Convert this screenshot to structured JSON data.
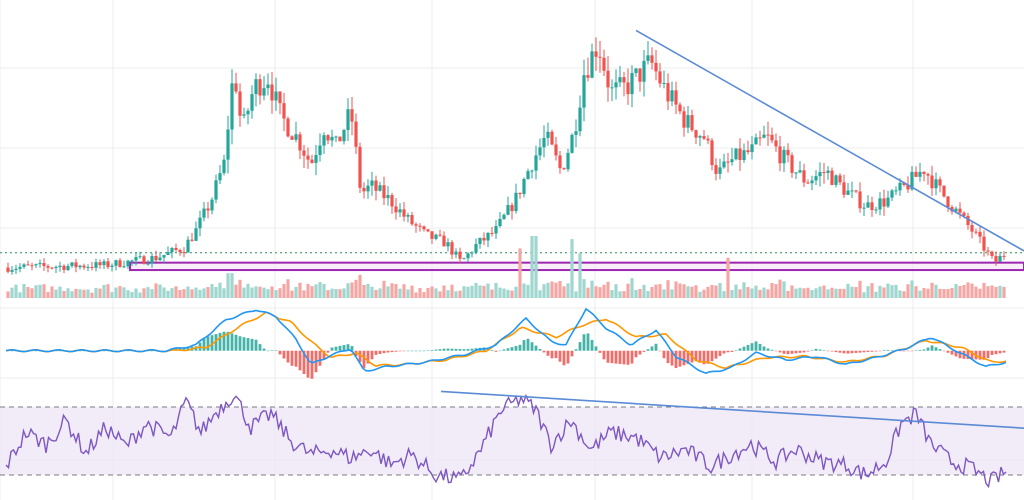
{
  "colors": {
    "up": "#26a69a",
    "down": "#ef5350",
    "volume_up": "#9fd6cf",
    "volume_down": "#f3a6a3",
    "grid": "#ececec",
    "trendline": "#5b8bd6",
    "support_zone_stroke": "#9c27b0",
    "support_zone_fill": "#f3e5f5",
    "dotted_level": "#2e8b57",
    "macd_line": "#2196f3",
    "signal_line": "#ff9800",
    "rsi_line": "#7e57c2",
    "rsi_band_fill": "#ede7f6",
    "rsi_band_stroke": "#787b86"
  },
  "chart_data": [
    {
      "type": "candlestick",
      "panel": "price",
      "title": "",
      "xlabel": "",
      "ylabel": "",
      "grid": true,
      "ylim": [
        0,
        100
      ],
      "x_range": [
        0,
        1
      ],
      "price_path": [
        [
          0.0,
          3
        ],
        [
          0.1,
          4
        ],
        [
          0.15,
          7
        ],
        [
          0.178,
          11
        ],
        [
          0.19,
          18
        ],
        [
          0.205,
          30
        ],
        [
          0.218,
          45
        ],
        [
          0.228,
          84
        ],
        [
          0.236,
          58
        ],
        [
          0.248,
          76
        ],
        [
          0.262,
          80
        ],
        [
          0.275,
          64
        ],
        [
          0.292,
          55
        ],
        [
          0.305,
          45
        ],
        [
          0.318,
          60
        ],
        [
          0.33,
          52
        ],
        [
          0.345,
          66
        ],
        [
          0.355,
          33
        ],
        [
          0.365,
          36
        ],
        [
          0.385,
          30
        ],
        [
          0.4,
          23
        ],
        [
          0.42,
          16
        ],
        [
          0.44,
          13
        ],
        [
          0.455,
          5
        ],
        [
          0.47,
          12
        ],
        [
          0.49,
          18
        ],
        [
          0.51,
          31
        ],
        [
          0.525,
          45
        ],
        [
          0.54,
          56
        ],
        [
          0.555,
          42
        ],
        [
          0.568,
          58
        ],
        [
          0.578,
          82
        ],
        [
          0.592,
          94
        ],
        [
          0.605,
          74
        ],
        [
          0.62,
          76
        ],
        [
          0.635,
          82
        ],
        [
          0.645,
          86
        ],
        [
          0.66,
          74
        ],
        [
          0.68,
          62
        ],
        [
          0.698,
          56
        ],
        [
          0.712,
          41
        ],
        [
          0.728,
          47
        ],
        [
          0.745,
          50
        ],
        [
          0.76,
          56
        ],
        [
          0.78,
          46
        ],
        [
          0.8,
          38
        ],
        [
          0.82,
          42
        ],
        [
          0.84,
          34
        ],
        [
          0.86,
          28
        ],
        [
          0.88,
          30
        ],
        [
          0.9,
          36
        ],
        [
          0.918,
          43
        ],
        [
          0.932,
          35
        ],
        [
          0.95,
          26
        ],
        [
          0.968,
          17
        ],
        [
          0.988,
          5
        ],
        [
          1.0,
          9
        ]
      ],
      "trendlines": [
        {
          "x": [
            0.63,
            1.0
          ],
          "y": [
            99,
            13
          ]
        }
      ],
      "support_zone": {
        "x": [
          0.15,
          1.0
        ],
        "y": [
          2,
          5
        ]
      },
      "reference_level": {
        "y": 9
      }
    },
    {
      "type": "bar",
      "panel": "volume",
      "title": "",
      "xlabel": "",
      "ylabel": "",
      "ylim": [
        0,
        100
      ],
      "spikes": [
        {
          "x": 0.224,
          "value": 40
        },
        {
          "x": 0.515,
          "value": 80
        },
        {
          "x": 0.528,
          "value": 100
        },
        {
          "x": 0.565,
          "value": 95
        },
        {
          "x": 0.574,
          "value": 72
        },
        {
          "x": 0.722,
          "value": 65
        }
      ]
    },
    {
      "type": "line",
      "panel": "macd",
      "title": "",
      "xlabel": "",
      "ylabel": "",
      "ylim": [
        -30,
        40
      ],
      "series": [
        {
          "role": "macd",
          "values": [
            [
              0.0,
              0
            ],
            [
              0.16,
              0
            ],
            [
              0.19,
              5
            ],
            [
              0.22,
              27
            ],
            [
              0.25,
              36
            ],
            [
              0.27,
              30
            ],
            [
              0.29,
              10
            ],
            [
              0.305,
              -12
            ],
            [
              0.325,
              -4
            ],
            [
              0.345,
              2
            ],
            [
              0.358,
              -18
            ],
            [
              0.38,
              -14
            ],
            [
              0.42,
              -10
            ],
            [
              0.46,
              -3
            ],
            [
              0.49,
              5
            ],
            [
              0.52,
              28
            ],
            [
              0.545,
              8
            ],
            [
              0.56,
              5
            ],
            [
              0.58,
              37
            ],
            [
              0.6,
              20
            ],
            [
              0.625,
              5
            ],
            [
              0.65,
              18
            ],
            [
              0.67,
              -5
            ],
            [
              0.7,
              -20
            ],
            [
              0.725,
              -15
            ],
            [
              0.75,
              -2
            ],
            [
              0.78,
              -8
            ],
            [
              0.81,
              -5
            ],
            [
              0.84,
              -12
            ],
            [
              0.87,
              -6
            ],
            [
              0.9,
              2
            ],
            [
              0.925,
              12
            ],
            [
              0.95,
              0
            ],
            [
              0.98,
              -14
            ],
            [
              1.0,
              -10
            ]
          ]
        },
        {
          "role": "signal",
          "values": [
            [
              0.0,
              0
            ],
            [
              0.17,
              0
            ],
            [
              0.2,
              3
            ],
            [
              0.235,
              22
            ],
            [
              0.26,
              33
            ],
            [
              0.285,
              25
            ],
            [
              0.305,
              8
            ],
            [
              0.325,
              -6
            ],
            [
              0.35,
              -2
            ],
            [
              0.37,
              -13
            ],
            [
              0.4,
              -12
            ],
            [
              0.44,
              -8
            ],
            [
              0.48,
              0
            ],
            [
              0.515,
              20
            ],
            [
              0.55,
              12
            ],
            [
              0.575,
              22
            ],
            [
              0.6,
              28
            ],
            [
              0.63,
              12
            ],
            [
              0.66,
              14
            ],
            [
              0.69,
              -8
            ],
            [
              0.72,
              -15
            ],
            [
              0.76,
              -6
            ],
            [
              0.8,
              -5
            ],
            [
              0.84,
              -10
            ],
            [
              0.88,
              -4
            ],
            [
              0.92,
              9
            ],
            [
              0.955,
              3
            ],
            [
              0.985,
              -10
            ],
            [
              1.0,
              -9
            ]
          ]
        }
      ]
    },
    {
      "type": "line",
      "panel": "rsi",
      "title": "",
      "xlabel": "",
      "ylabel": "",
      "ylim": [
        20,
        80
      ],
      "bands": [
        30,
        70
      ],
      "series": [
        {
          "role": "rsi",
          "values": [
            [
              0.0,
              35
            ],
            [
              0.02,
              55
            ],
            [
              0.04,
              48
            ],
            [
              0.06,
              62
            ],
            [
              0.08,
              43
            ],
            [
              0.1,
              58
            ],
            [
              0.12,
              47
            ],
            [
              0.14,
              60
            ],
            [
              0.165,
              52
            ],
            [
              0.18,
              73
            ],
            [
              0.195,
              55
            ],
            [
              0.21,
              67
            ],
            [
              0.228,
              78
            ],
            [
              0.245,
              58
            ],
            [
              0.265,
              66
            ],
            [
              0.285,
              50
            ],
            [
              0.305,
              42
            ],
            [
              0.325,
              45
            ],
            [
              0.345,
              40
            ],
            [
              0.365,
              45
            ],
            [
              0.385,
              36
            ],
            [
              0.405,
              42
            ],
            [
              0.43,
              30
            ],
            [
              0.455,
              27
            ],
            [
              0.475,
              45
            ],
            [
              0.495,
              68
            ],
            [
              0.515,
              75
            ],
            [
              0.53,
              68
            ],
            [
              0.545,
              48
            ],
            [
              0.565,
              62
            ],
            [
              0.585,
              45
            ],
            [
              0.605,
              55
            ],
            [
              0.63,
              52
            ],
            [
              0.655,
              40
            ],
            [
              0.68,
              45
            ],
            [
              0.705,
              35
            ],
            [
              0.725,
              42
            ],
            [
              0.745,
              48
            ],
            [
              0.77,
              38
            ],
            [
              0.79,
              45
            ],
            [
              0.815,
              38
            ],
            [
              0.84,
              36
            ],
            [
              0.86,
              30
            ],
            [
              0.88,
              38
            ],
            [
              0.895,
              60
            ],
            [
              0.91,
              66
            ],
            [
              0.925,
              48
            ],
            [
              0.945,
              38
            ],
            [
              0.965,
              34
            ],
            [
              0.985,
              26
            ],
            [
              1.0,
              32
            ]
          ]
        }
      ],
      "trendlines": [
        {
          "x": [
            0.435,
            1.0
          ],
          "y": [
            82,
            48
          ]
        }
      ]
    }
  ]
}
